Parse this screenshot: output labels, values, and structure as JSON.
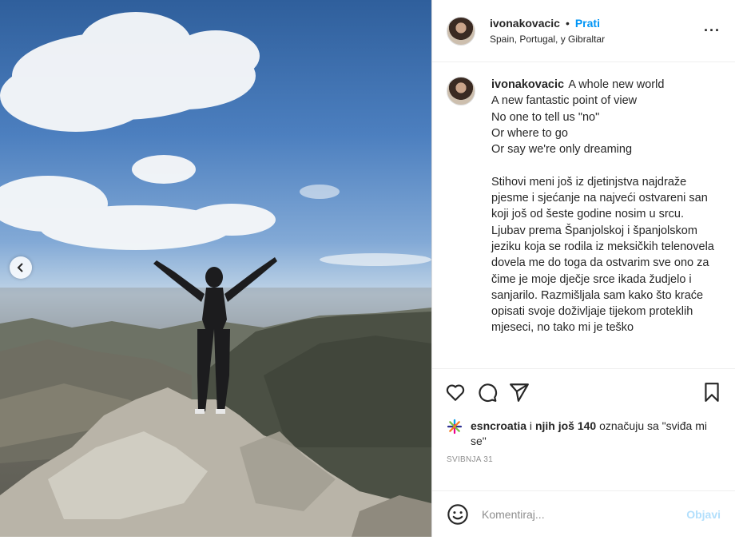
{
  "post": {
    "author": "ivonakovacic",
    "follow_label": "Prati",
    "location": "Spain, Portugal, y Gibraltar",
    "more_icon": "more-horizontal-icon"
  },
  "caption": {
    "author": "ivonakovacic",
    "text": "A whole new world\nA new fantastic point of view\nNo one to tell us \"no\"\nOr where to go\nOr say we're only dreaming\n\nStihovi meni još iz djetinjstva najdraže pjesme i sjećanje na najveći ostvareni san koji još od šeste godine nosim u srcu.\nLjubav prema Španjolskoj i španjolskom jeziku koja se rodila iz meksičkih telenovela dovela me do toga da ostvarim sve ono za čime je moje dječje srce ikada žudjelo i sanjarilo. Razmišljala sam kako što kraće opisati svoje doživljaje tijekom proteklih mjeseci, no tako mi je teško"
  },
  "actions": {
    "like_icon": "heart-icon",
    "comment_icon": "comment-icon",
    "share_icon": "paper-plane-icon",
    "save_icon": "bookmark-icon"
  },
  "likes": {
    "user": "esncroatia",
    "connector": " i ",
    "others": "njih još 140",
    "suffix": " označuju sa \"sviđa mi se\""
  },
  "date": "SVIBNJA 31",
  "comment": {
    "placeholder": "Komentiraj...",
    "post_label": "Objavi",
    "emoji_icon": "smiley-icon"
  },
  "colors": {
    "accent": "#0095f6",
    "post_disabled": "#b2dffc",
    "text": "#262626",
    "muted": "#8e8e8e"
  }
}
